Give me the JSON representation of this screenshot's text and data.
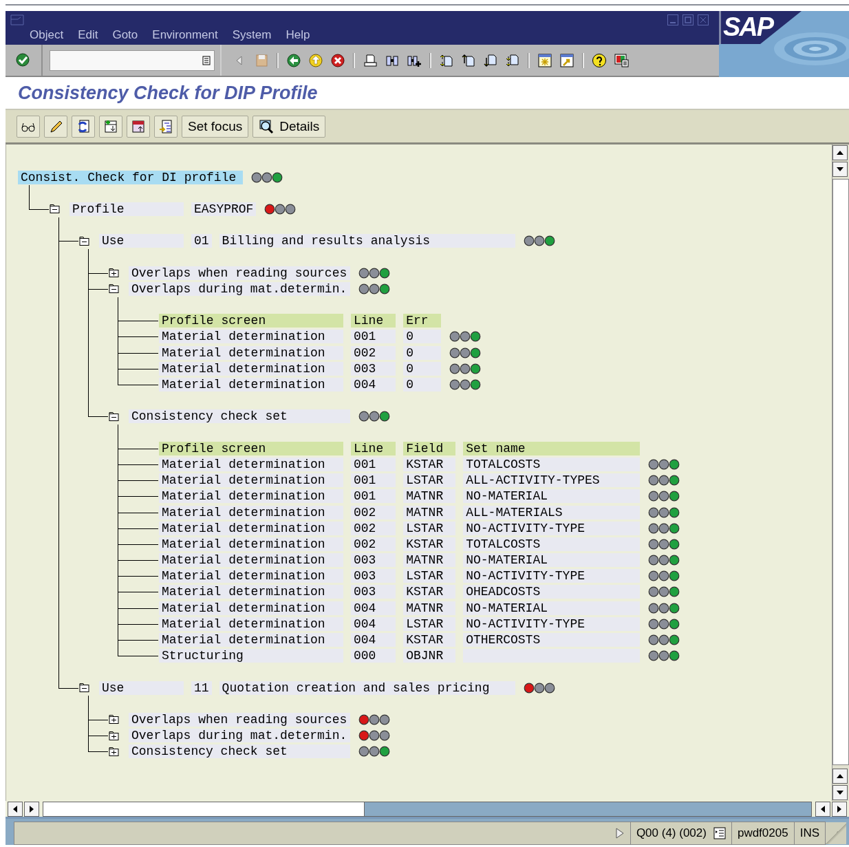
{
  "menu": [
    "Object",
    "Edit",
    "Goto",
    "Environment",
    "System",
    "Help"
  ],
  "logo": "SAP",
  "title": "Consistency Check for DIP Profile",
  "app_toolbar": [
    {
      "label": "Set focus"
    },
    {
      "label": "Details"
    }
  ],
  "tree": {
    "kind": "root",
    "label": "Consist. Check for DI profile",
    "selected": true,
    "error": false,
    "ok": true,
    "children": [
      {
        "kind": "node",
        "label": "Profile",
        "value": "EASYPROF",
        "error": true,
        "ok": false,
        "expanded": true,
        "children": [
          {
            "kind": "node",
            "label": "Use",
            "number": "01",
            "value": "Billing and results analysis",
            "error": false,
            "ok": true,
            "expanded": true,
            "children": [
              {
                "kind": "folder",
                "label": "Overlaps when reading sources",
                "error": false,
                "ok": true,
                "expanded": false
              },
              {
                "kind": "folder",
                "label": "Overlaps during mat.determin.",
                "error": false,
                "ok": true,
                "expanded": true,
                "children": [
                  {
                    "kind": "table",
                    "columns": [
                      "Profile screen",
                      "Line",
                      "Err"
                    ],
                    "rows": [
                      {
                        "cells": [
                          "Material determination",
                          "001",
                          "0"
                        ],
                        "error": false,
                        "ok": true
                      },
                      {
                        "cells": [
                          "Material determination",
                          "002",
                          "0"
                        ],
                        "error": false,
                        "ok": true
                      },
                      {
                        "cells": [
                          "Material determination",
                          "003",
                          "0"
                        ],
                        "error": false,
                        "ok": true
                      },
                      {
                        "cells": [
                          "Material determination",
                          "004",
                          "0"
                        ],
                        "error": false,
                        "ok": true
                      }
                    ]
                  }
                ]
              },
              {
                "kind": "folder",
                "label": "Consistency check set",
                "error": false,
                "ok": true,
                "expanded": true,
                "children": [
                  {
                    "kind": "table",
                    "columns": [
                      "Profile screen",
                      "Line",
                      "Field",
                      "Set name"
                    ],
                    "rows": [
                      {
                        "cells": [
                          "Material determination",
                          "001",
                          "KSTAR",
                          "TOTALCOSTS"
                        ],
                        "error": false,
                        "ok": true
                      },
                      {
                        "cells": [
                          "Material determination",
                          "001",
                          "LSTAR",
                          "ALL-ACTIVITY-TYPES"
                        ],
                        "error": false,
                        "ok": true
                      },
                      {
                        "cells": [
                          "Material determination",
                          "001",
                          "MATNR",
                          "NO-MATERIAL"
                        ],
                        "error": false,
                        "ok": true
                      },
                      {
                        "cells": [
                          "Material determination",
                          "002",
                          "MATNR",
                          "ALL-MATERIALS"
                        ],
                        "error": false,
                        "ok": true
                      },
                      {
                        "cells": [
                          "Material determination",
                          "002",
                          "LSTAR",
                          "NO-ACTIVITY-TYPE"
                        ],
                        "error": false,
                        "ok": true
                      },
                      {
                        "cells": [
                          "Material determination",
                          "002",
                          "KSTAR",
                          "TOTALCOSTS"
                        ],
                        "error": false,
                        "ok": true
                      },
                      {
                        "cells": [
                          "Material determination",
                          "003",
                          "MATNR",
                          "NO-MATERIAL"
                        ],
                        "error": false,
                        "ok": true
                      },
                      {
                        "cells": [
                          "Material determination",
                          "003",
                          "LSTAR",
                          "NO-ACTIVITY-TYPE"
                        ],
                        "error": false,
                        "ok": true
                      },
                      {
                        "cells": [
                          "Material determination",
                          "003",
                          "KSTAR",
                          "OHEADCOSTS"
                        ],
                        "error": false,
                        "ok": true
                      },
                      {
                        "cells": [
                          "Material determination",
                          "004",
                          "MATNR",
                          "NO-MATERIAL"
                        ],
                        "error": false,
                        "ok": true
                      },
                      {
                        "cells": [
                          "Material determination",
                          "004",
                          "LSTAR",
                          "NO-ACTIVITY-TYPE"
                        ],
                        "error": false,
                        "ok": true
                      },
                      {
                        "cells": [
                          "Material determination",
                          "004",
                          "KSTAR",
                          "OTHERCOSTS"
                        ],
                        "error": false,
                        "ok": true
                      },
                      {
                        "cells": [
                          "Structuring",
                          "000",
                          "OBJNR",
                          ""
                        ],
                        "error": false,
                        "ok": true
                      }
                    ]
                  }
                ]
              }
            ]
          },
          {
            "kind": "node",
            "label": "Use",
            "number": "11",
            "value": "Quotation creation and sales pricing",
            "error": true,
            "ok": false,
            "expanded": true,
            "children": [
              {
                "kind": "folder",
                "label": "Overlaps when reading sources",
                "error": true,
                "ok": false,
                "expanded": false
              },
              {
                "kind": "folder",
                "label": "Overlaps during mat.determin.",
                "error": true,
                "ok": false,
                "expanded": false
              },
              {
                "kind": "folder",
                "label": "Consistency check set",
                "error": false,
                "ok": true,
                "expanded": false
              }
            ]
          }
        ]
      }
    ]
  },
  "status_bar": {
    "system": "Q00 (4) (002)",
    "server": "pwdf0205",
    "mode": "INS"
  }
}
